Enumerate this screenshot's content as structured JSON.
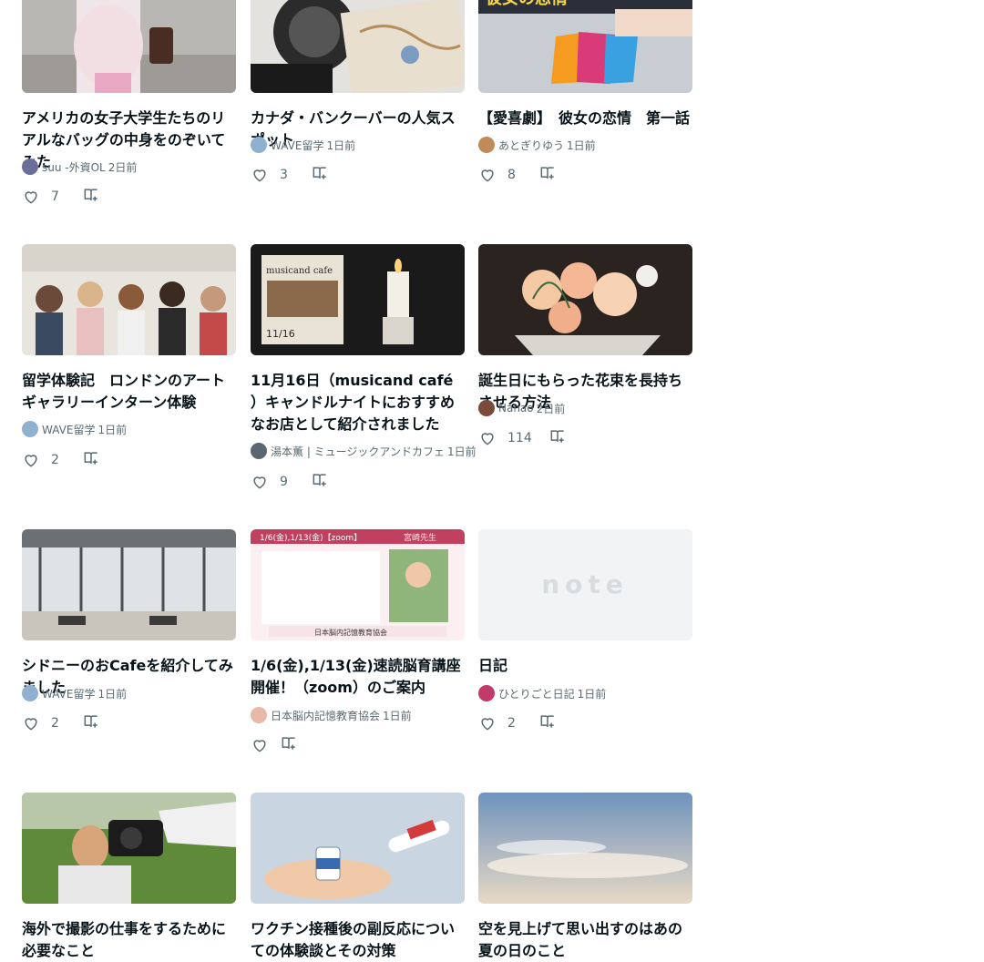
{
  "cards": [
    {
      "title": "アメリカの女子大学生たちのリアルなバッグの中身をのぞいてみた",
      "author": "suu -外資OL",
      "time": "2日前",
      "likes": "7",
      "avatar_color": "#6a6f9a"
    },
    {
      "title": "カナダ・バンクーバーの人気スポット",
      "author": "WAVE留学",
      "time": "1日前",
      "likes": "3",
      "avatar_color": "#8fb0cf"
    },
    {
      "title": "【愛喜劇】　彼女の恋情　第一話",
      "author": "あとぎりゆう",
      "time": "1日前",
      "likes": "8",
      "avatar_color": "#c08a5a"
    },
    {
      "title": "留学体験記　ロンドンのアートギャラリーインターン体験",
      "author": "WAVE留学",
      "time": "1日前",
      "likes": "2",
      "avatar_color": "#8fb0cf"
    },
    {
      "title": "11月16日（musicand café ）キャンドルナイトにおすすめなお店として紹介されました",
      "author": "湯本薫 | ミュージックアンドカフェ",
      "time": "1日前",
      "likes": "9",
      "avatar_color": "#5b6670"
    },
    {
      "title": "誕生日にもらった花束を長持ちさせる方法",
      "author": "Nanao",
      "time": "2日前",
      "likes": "114",
      "avatar_color": "#7a4a3a"
    },
    {
      "title": "シドニーのおCafeを紹介してみました",
      "author": "WAVE留学",
      "time": "1日前",
      "likes": "2",
      "avatar_color": "#8fb0cf"
    },
    {
      "title": "1/6(金),1/13(金)速読脳育講座開催！（zoom）のご案内",
      "author": "日本脳内記憶教育協会",
      "time": "1日前",
      "likes": "",
      "avatar_color": "#e8b8a8"
    },
    {
      "title": "日記",
      "author": "ひとりごと日記",
      "time": "1日前",
      "likes": "2",
      "avatar_color": "#c03a6a"
    },
    {
      "title": "海外で撮影の仕事をするために必要なこと",
      "author": "",
      "time": "",
      "likes": "",
      "avatar_color": "#888888"
    },
    {
      "title": "ワクチン接種後の副反応についての体験談とその対策",
      "author": "",
      "time": "",
      "likes": "",
      "avatar_color": "#888888"
    },
    {
      "title": "空を見上げて思い出すのはあの夏の日のこと",
      "author": "",
      "time": "",
      "likes": "",
      "avatar_color": "#888888"
    }
  ],
  "image_cards": {
    "card8_placeholder": "note",
    "card5_poster_text": "musicand cafe",
    "card5_poster_date": "11/16",
    "card8_banner_header": "1/6(金),1/13(金)【zoom】",
    "card8_banner_org": "日本脳内記憶教育協会",
    "card8_banner_teacher": "宮崎先生",
    "card3_banner": "彼女の恋情"
  },
  "icons": {
    "like": "heart-outline-icon",
    "save": "magazine-add-icon"
  }
}
